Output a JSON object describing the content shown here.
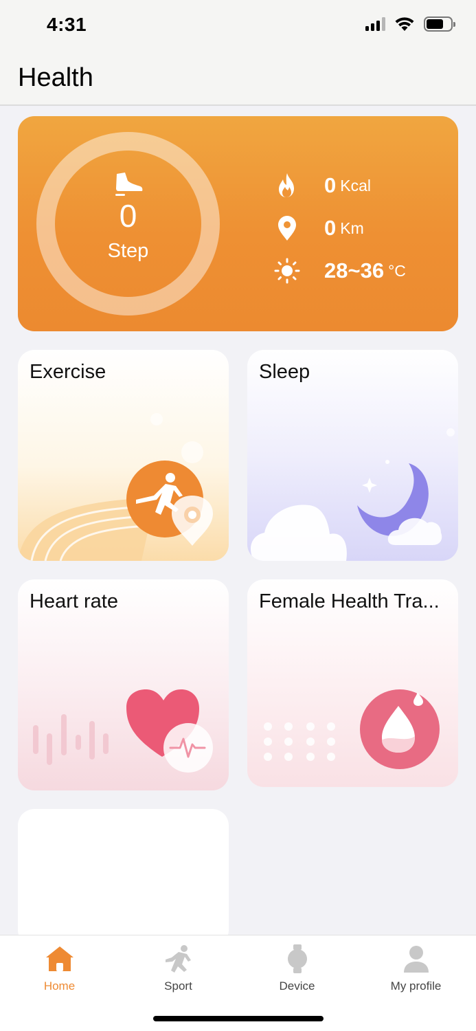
{
  "status_bar": {
    "time": "4:31"
  },
  "header": {
    "title": "Health"
  },
  "summary": {
    "steps": "0",
    "steps_label": "Step",
    "calories": "0",
    "calories_unit": "Kcal",
    "distance": "0",
    "distance_unit": "Km",
    "temperature": "28~36",
    "temperature_unit": "°C"
  },
  "cards": {
    "exercise": "Exercise",
    "sleep": "Sleep",
    "heart_rate": "Heart rate",
    "female_health": "Female Health Tra..."
  },
  "tabbar": {
    "home": "Home",
    "sport": "Sport",
    "device": "Device",
    "profile": "My profile"
  },
  "colors": {
    "accent": "#ee8a33",
    "inactive_tab": "#c8c8c8"
  }
}
